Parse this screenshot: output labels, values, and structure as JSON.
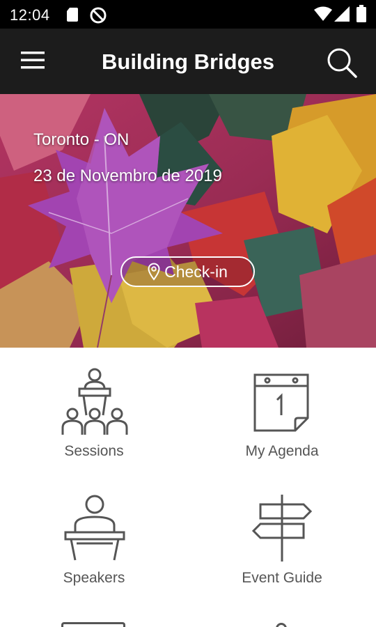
{
  "status_bar": {
    "time": "12:04",
    "icons": [
      "sd-card-icon",
      "do-not-disturb-icon",
      "wifi-icon",
      "signal-icon",
      "battery-icon"
    ]
  },
  "app_bar": {
    "title": "Building Bridges",
    "menu_icon": "hamburger-menu-icon",
    "search_icon": "search-icon"
  },
  "hero": {
    "location": "Toronto - ON",
    "date": "23 de Novembro de 2019",
    "checkin_label": "Check-in",
    "checkin_icon": "location-pin-icon"
  },
  "menu": [
    {
      "label": "Sessions",
      "icon": "audience-podium-icon"
    },
    {
      "label": "My Agenda",
      "icon": "calendar-icon"
    },
    {
      "label": "Speakers",
      "icon": "speaker-podium-icon"
    },
    {
      "label": "Event Guide",
      "icon": "signpost-icon"
    }
  ],
  "colors": {
    "status_bar": "#000000",
    "app_bar": "#1c1c1c",
    "tile_icon": "#555555",
    "tile_label": "#555555"
  }
}
